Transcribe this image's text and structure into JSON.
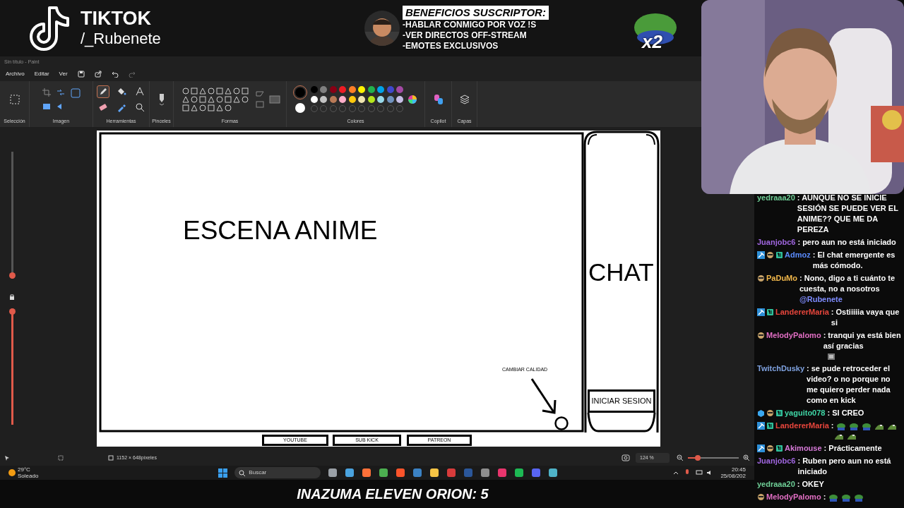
{
  "overlay": {
    "brand": "TIKTOK",
    "handle": "/_Rubenete",
    "benefits_title": "BENEFICIOS SUSCRIPTOR:",
    "benefits": [
      "-HABLAR CONMIGO POR VOZ !S",
      "-VER DIRECTOS OFF-STREAM",
      "-EMOTES EXCLUSIVOS"
    ],
    "badge_text": "x2"
  },
  "paint": {
    "title": "Sin título - Paint",
    "menus": [
      "Archivo",
      "Editar",
      "Ver"
    ],
    "groups": [
      "Selección",
      "Imagen",
      "Herramientas",
      "Pinceles",
      "Formas",
      "Colores",
      "Copilot",
      "Capas"
    ],
    "tools": [
      {
        "kind": "pencil",
        "selected": true
      },
      {
        "kind": "fill",
        "selected": false
      },
      {
        "kind": "text",
        "selected": false
      },
      {
        "kind": "eraser",
        "selected": false
      },
      {
        "kind": "picker",
        "selected": false
      },
      {
        "kind": "magnifier",
        "selected": false
      }
    ],
    "current_colors": [
      {
        "color": "#000000"
      },
      {
        "color": "#ffffff"
      }
    ],
    "palette": [
      {
        "color": "#000000"
      },
      {
        "color": "#7f7f7f"
      },
      {
        "color": "#880015"
      },
      {
        "color": "#ed1c24"
      },
      {
        "color": "#ff7f27"
      },
      {
        "color": "#fff200"
      },
      {
        "color": "#22b14c"
      },
      {
        "color": "#00a2e8"
      },
      {
        "color": "#3f48cc"
      },
      {
        "color": "#a349a4"
      },
      {
        "color": "#ffffff"
      },
      {
        "color": "#c3c3c3"
      },
      {
        "color": "#b97a57"
      },
      {
        "color": "#ffaec9"
      },
      {
        "color": "#ffc90e"
      },
      {
        "color": "#efe4b0"
      },
      {
        "color": "#b5e61d"
      },
      {
        "color": "#99d9ea"
      },
      {
        "color": "#7092be"
      },
      {
        "color": "#c8bfe7"
      }
    ],
    "sliders": [
      {
        "level": 0.02
      },
      {
        "level": 0.97
      }
    ],
    "canvas": {
      "scene_label": "ESCENA ANIME",
      "chat_label": "CHAT",
      "quality_label": "CAMBIAR CALIDAD",
      "login_label": "INICIAR SESION",
      "links": [
        "YOUTUBE",
        "SUB KICK",
        "PATREON"
      ]
    },
    "status": {
      "size": "1152 × 648píxeles",
      "zoom": "124 %",
      "zoom_level": {
        "level": 0.2
      }
    }
  },
  "taskbar": {
    "temperature": "29°C",
    "weather": "Soleado",
    "search_placeholder": "Buscar",
    "time": "20:45",
    "date": "25/08/202",
    "apps": [
      {
        "color": "#9aa0a6"
      },
      {
        "color": "#4aa3df"
      },
      {
        "color": "#ff7139"
      },
      {
        "color": "#4caf50"
      },
      {
        "color": "#fb542b"
      },
      {
        "color": "#3b82c4"
      },
      {
        "color": "#f6c445"
      },
      {
        "color": "#d83b3b"
      },
      {
        "color": "#2b579a"
      },
      {
        "color": "#8e8e8e"
      },
      {
        "color": "#e8356d"
      },
      {
        "color": "#1db954"
      },
      {
        "color": "#5865f2"
      },
      {
        "color": "#4fb3c8"
      }
    ]
  },
  "caption": "INAZUMA ELEVEN ORION: 5",
  "chat": [
    {
      "user": "yedraaa20",
      "color": "#6fcf97",
      "text": ": AUNQUE NO SE INICIE SESIÓN SE PUEDE VER EL ANIME?? QUE ME DA PEREZA"
    },
    {
      "user": "Juanjobc6",
      "color": "#a066e0",
      "text": ": pero aun no está iniciado"
    },
    {
      "user": "Admoz",
      "color": "#5b8cff",
      "badges": [
        {
          "kind": "pickaxe"
        },
        {
          "kind": "face"
        },
        {
          "kind": "tag"
        }
      ],
      "text": ": El chat emergente es más cómodo."
    },
    {
      "user": "PaDuMo",
      "color": "#f2b84b",
      "badges": [
        {
          "kind": "face"
        }
      ],
      "text": ": Nono, digo a ti cuánto te cuesta, no a nosotros",
      "mention": "@Rubenete"
    },
    {
      "user": "LandererMaria",
      "color": "#e8463c",
      "badges": [
        {
          "kind": "pickaxe"
        },
        {
          "kind": "tag"
        }
      ],
      "text": ": Ostiiiiia vaya que si"
    },
    {
      "user": "MelodyPalomo",
      "color": "#e26fc4",
      "badges": [
        {
          "kind": "face"
        }
      ],
      "text": ": tranqui ya está bien así gracias",
      "emotes": [
        {
          "kind": "chip"
        }
      ]
    },
    {
      "user": "TwitchDusky",
      "color": "#7fa2e0",
      "text": ": se pude retroceder el video? o no porque no me quiero perder nada como en kick"
    },
    {
      "user": "yaguito078",
      "color": "#3fd6a6",
      "badges": [
        {
          "kind": "cube"
        },
        {
          "kind": "face"
        },
        {
          "kind": "tag"
        }
      ],
      "text": ": SI CREO"
    },
    {
      "user": "LandererMaria",
      "color": "#e8463c",
      "badges": [
        {
          "kind": "pickaxe"
        },
        {
          "kind": "tag"
        }
      ],
      "text": ":",
      "emotes": [
        {
          "kind": "frog"
        },
        {
          "kind": "frog"
        },
        {
          "kind": "frog"
        },
        {
          "kind": "frog2"
        },
        {
          "kind": "frog2"
        },
        {
          "kind": "frog2"
        },
        {
          "kind": "frog2"
        }
      ]
    },
    {
      "user": "Akimouse",
      "color": "#d77ad8",
      "badges": [
        {
          "kind": "pickaxe"
        },
        {
          "kind": "face"
        },
        {
          "kind": "tag"
        }
      ],
      "text": ": Prácticamente"
    },
    {
      "user": "Juanjobc6",
      "color": "#a066e0",
      "text": ": Ruben pero aun no está iniciado"
    },
    {
      "user": "yedraaa20",
      "color": "#6fcf97",
      "text": ": OKEY"
    },
    {
      "user": "MelodyPalomo",
      "color": "#e26fc4",
      "badges": [
        {
          "kind": "face"
        }
      ],
      "text": ":",
      "emotes": [
        {
          "kind": "frog"
        },
        {
          "kind": "frog"
        },
        {
          "kind": "frog"
        }
      ]
    }
  ]
}
